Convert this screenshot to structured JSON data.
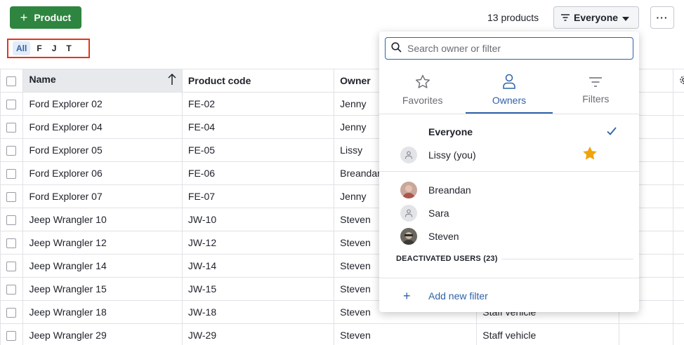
{
  "toolbar": {
    "add_label": "Product",
    "count_text": "13 products",
    "owner_filter_label": "Everyone",
    "more_label": "···"
  },
  "alpha_filter": [
    "All",
    "F",
    "J",
    "T"
  ],
  "table": {
    "columns": [
      "Name",
      "Product code",
      "Owner",
      "",
      "",
      ""
    ],
    "rows": [
      {
        "name": "Ford Explorer 02",
        "code": "FE-02",
        "owner": "Jenny",
        "category": ""
      },
      {
        "name": "Ford Explorer 04",
        "code": "FE-04",
        "owner": "Jenny",
        "category": ""
      },
      {
        "name": "Ford Explorer 05",
        "code": "FE-05",
        "owner": "Lissy",
        "category": ""
      },
      {
        "name": "Ford Explorer 06",
        "code": "FE-06",
        "owner": "Breandan",
        "category": ""
      },
      {
        "name": "Ford Explorer 07",
        "code": "FE-07",
        "owner": "Jenny",
        "category": ""
      },
      {
        "name": "Jeep Wrangler 10",
        "code": "JW-10",
        "owner": "Steven",
        "category": ""
      },
      {
        "name": "Jeep Wrangler 12",
        "code": "JW-12",
        "owner": "Steven",
        "category": ""
      },
      {
        "name": "Jeep Wrangler 14",
        "code": "JW-14",
        "owner": "Steven",
        "category": ""
      },
      {
        "name": "Jeep Wrangler 15",
        "code": "JW-15",
        "owner": "Steven",
        "category": ""
      },
      {
        "name": "Jeep Wrangler 18",
        "code": "JW-18",
        "owner": "Steven",
        "category": "Staff vehicle"
      },
      {
        "name": "Jeep Wrangler 29",
        "code": "JW-29",
        "owner": "Steven",
        "category": "Staff vehicle"
      }
    ]
  },
  "dropdown": {
    "search_placeholder": "Search owner or filter",
    "tabs": [
      "Favorites",
      "Owners",
      "Filters"
    ],
    "everyone_label": "Everyone",
    "current_user_label": "Lissy (you)",
    "users": [
      "Breandan",
      "Sara",
      "Steven"
    ],
    "deactivated_label": "DEACTIVATED USERS (23)",
    "add_filter_label": "Add new filter"
  },
  "colors": {
    "brand_green": "#2e8540",
    "accent_blue": "#2e62a8",
    "star": "#f0a30a",
    "highlight_red": "#e5341a"
  }
}
